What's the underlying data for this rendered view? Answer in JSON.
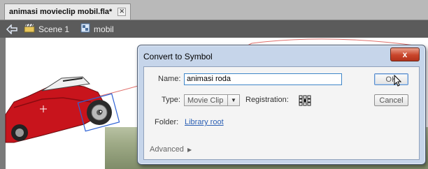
{
  "document_tab": {
    "title": "animasi movieclip mobil.fla*",
    "close_label": "✕"
  },
  "scene_bar": {
    "scene_label": "Scene 1",
    "symbol_label": "mobil"
  },
  "dialog": {
    "title": "Convert to Symbol",
    "close_label": "x",
    "name_label": "Name:",
    "name_value": "animasi roda",
    "type_label": "Type:",
    "type_value": "Movie Clip",
    "registration_label": "Registration:",
    "folder_label": "Folder:",
    "folder_value": "Library root",
    "advanced_label": "Advanced",
    "ok_label": "OK",
    "cancel_label": "Cancel"
  },
  "colors": {
    "car_body": "#c8141c",
    "selection": "#2f63d6",
    "motion_path": "#e0706c"
  }
}
